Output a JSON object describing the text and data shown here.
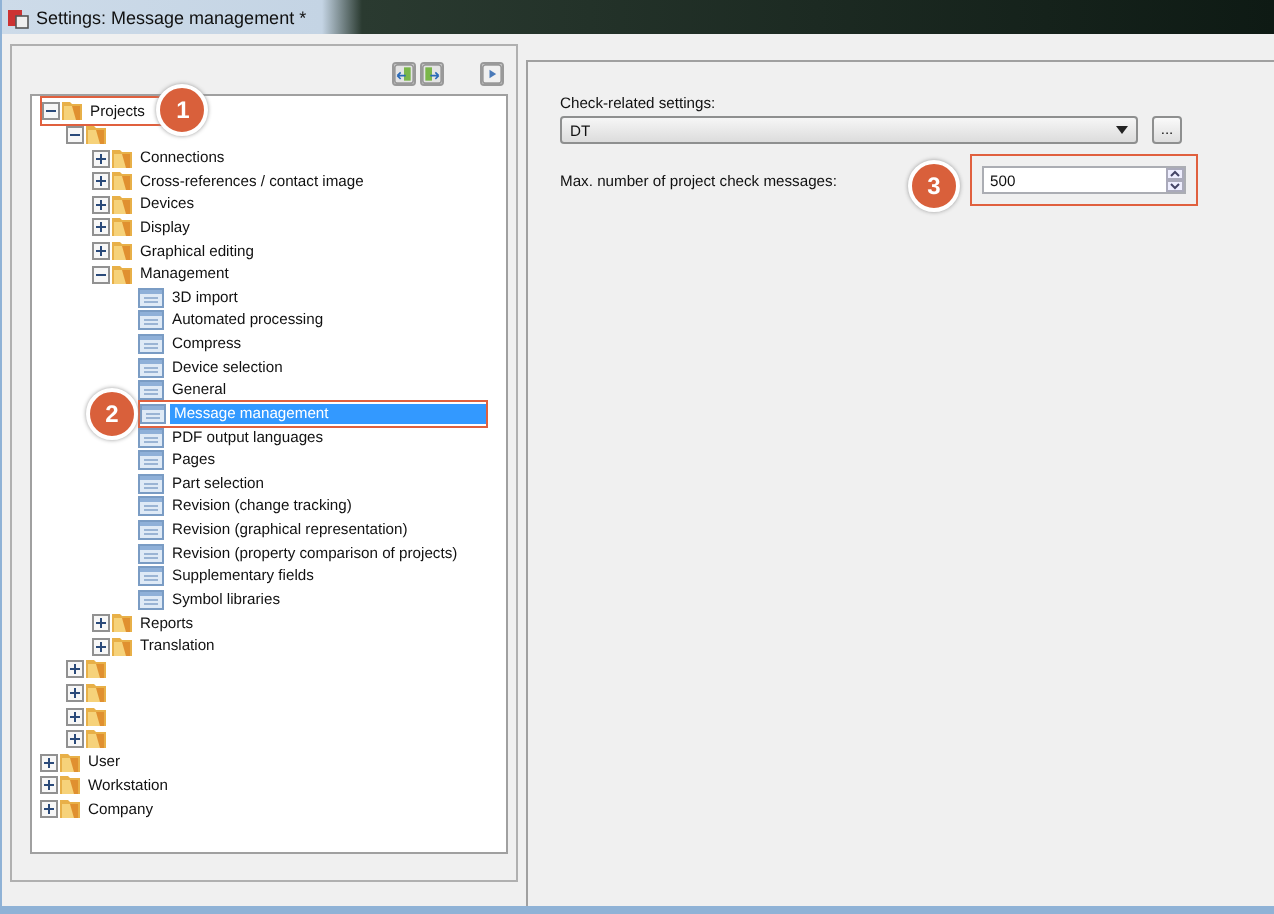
{
  "window": {
    "title": "Settings: Message management *"
  },
  "tree": [
    {
      "label": "Projects",
      "kind": "folder",
      "expanded": true,
      "selected": false,
      "callout": "1",
      "children": [
        {
          "kind": "folder",
          "expanded": true,
          "selected": false,
          "children": [
            {
              "label": "Connections",
              "kind": "folder",
              "expanded": false,
              "selected": false
            },
            {
              "label": "Cross-references / contact image",
              "kind": "folder",
              "expanded": false,
              "selected": false
            },
            {
              "label": "Devices",
              "kind": "folder",
              "expanded": false,
              "selected": false
            },
            {
              "label": "Display",
              "kind": "folder",
              "expanded": false,
              "selected": false
            },
            {
              "label": "Graphical editing",
              "kind": "folder",
              "expanded": false,
              "selected": false
            },
            {
              "label": "Management",
              "kind": "folder",
              "expanded": true,
              "selected": false,
              "children": [
                {
                  "label": "3D import",
                  "kind": "page",
                  "selected": false
                },
                {
                  "label": "Automated processing",
                  "kind": "page",
                  "selected": false
                },
                {
                  "label": "Compress",
                  "kind": "page",
                  "selected": false
                },
                {
                  "label": "Device selection",
                  "kind": "page",
                  "selected": false
                },
                {
                  "label": "General",
                  "kind": "page",
                  "selected": false
                },
                {
                  "label": "Message management",
                  "kind": "page",
                  "selected": true,
                  "callout": "2"
                },
                {
                  "label": "PDF output languages",
                  "kind": "page",
                  "selected": false
                },
                {
                  "label": "Pages",
                  "kind": "page",
                  "selected": false
                },
                {
                  "label": "Part selection",
                  "kind": "page",
                  "selected": false
                },
                {
                  "label": "Revision (change tracking)",
                  "kind": "page",
                  "selected": false
                },
                {
                  "label": "Revision (graphical representation)",
                  "kind": "page",
                  "selected": false
                },
                {
                  "label": "Revision (property comparison of projects)",
                  "kind": "page",
                  "selected": false
                },
                {
                  "label": "Supplementary fields",
                  "kind": "page",
                  "selected": false
                },
                {
                  "label": "Symbol libraries",
                  "kind": "page",
                  "selected": false
                }
              ]
            },
            {
              "label": "Reports",
              "kind": "folder",
              "expanded": false,
              "selected": false
            },
            {
              "label": "Translation",
              "kind": "folder",
              "expanded": false,
              "selected": false
            }
          ]
        },
        {
          "kind": "folder",
          "expanded": false,
          "selected": false
        },
        {
          "kind": "folder",
          "expanded": false,
          "selected": false
        },
        {
          "kind": "folder",
          "expanded": false,
          "selected": false
        },
        {
          "kind": "folder",
          "expanded": false,
          "selected": false
        }
      ]
    },
    {
      "label": "User",
      "kind": "folder",
      "expanded": false,
      "selected": false
    },
    {
      "label": "Workstation",
      "kind": "folder",
      "expanded": false,
      "selected": false
    },
    {
      "label": "Company",
      "kind": "folder",
      "expanded": false,
      "selected": false
    }
  ],
  "settings": {
    "check_label": "Check-related settings:",
    "check_value": "DT",
    "more_button": "...",
    "max_label": "Max. number of project check messages:",
    "max_value": "500",
    "callout": "3"
  }
}
